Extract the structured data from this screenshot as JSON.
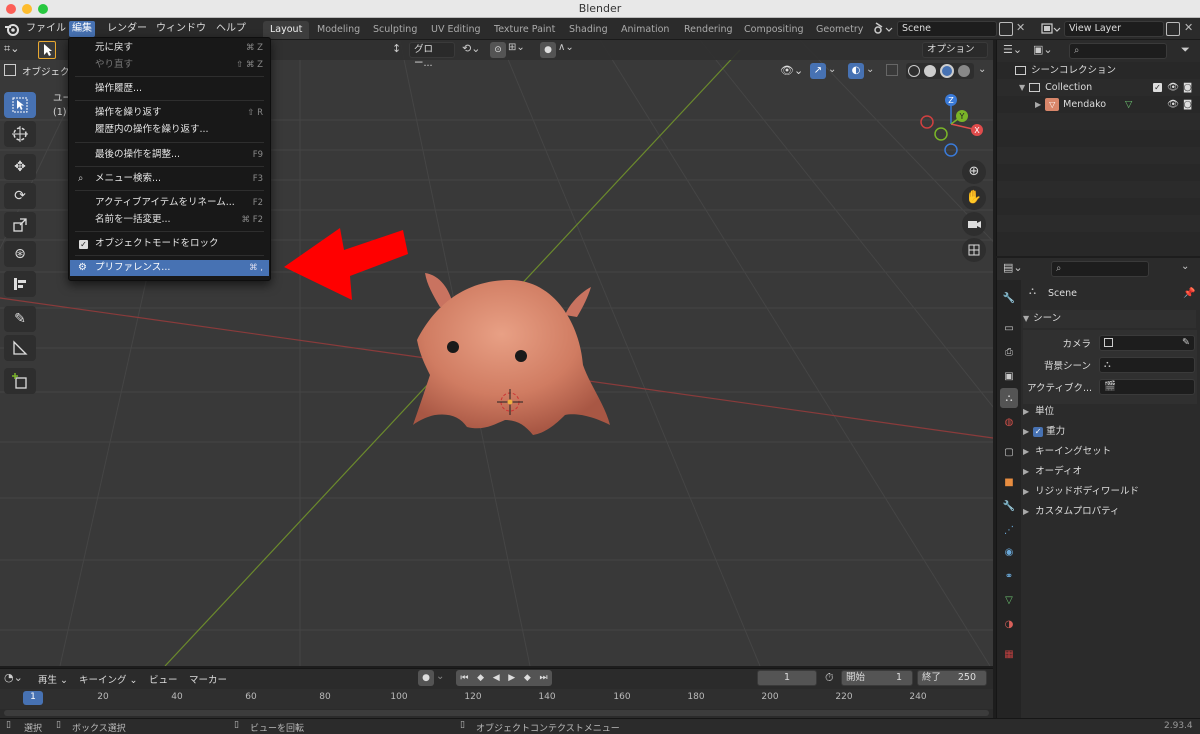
{
  "window": {
    "title": "Blender",
    "traffic_colors": [
      "#fc5f57",
      "#fdbc2e",
      "#28c840"
    ]
  },
  "menubar": {
    "items": [
      "ファイル",
      "編集",
      "レンダー",
      "ウィンドウ",
      "ヘルプ"
    ],
    "active_index": 1,
    "workspaces": [
      "Layout",
      "Modeling",
      "Sculpting",
      "UV Editing",
      "Texture Paint",
      "Shading",
      "Animation",
      "Rendering",
      "Compositing",
      "Geometry"
    ],
    "active_workspace": 0,
    "scene": "Scene",
    "view_layer": "View Layer"
  },
  "viewport": {
    "mode_label": "オブジェクト",
    "orientation": "グロー...",
    "options_label": "オプション",
    "info_line1": "ユー",
    "info_line2": "(1)",
    "gizmo_labels": {
      "z": "Z",
      "y": "Y",
      "x": "X"
    }
  },
  "edit_menu": {
    "items": [
      {
        "label": "元に戻す",
        "shortcut": "⌘ Z",
        "state": "normal"
      },
      {
        "label": "やり直す",
        "shortcut": "⇧ ⌘ Z",
        "state": "disabled"
      },
      {
        "label": "操作履歴...",
        "shortcut": "",
        "state": "normal"
      },
      {
        "label": "操作を繰り返す",
        "shortcut": "⇧ R",
        "state": "normal"
      },
      {
        "label": "履歴内の操作を繰り返す...",
        "shortcut": "",
        "state": "normal"
      },
      {
        "label": "最後の操作を調整...",
        "shortcut": "F9",
        "state": "normal"
      },
      {
        "label": "メニュー検索...",
        "shortcut": "F3",
        "state": "normal"
      },
      {
        "label": "アクティブアイテムをリネーム...",
        "shortcut": "F2",
        "state": "normal"
      },
      {
        "label": "名前を一括変更...",
        "shortcut": "⌘ F2",
        "state": "normal"
      },
      {
        "label": "オブジェクトモードをロック",
        "shortcut": "",
        "state": "normal"
      },
      {
        "label": "プリファレンス...",
        "shortcut": "⌘ ,",
        "state": "highlighted"
      }
    ]
  },
  "outliner": {
    "root": "シーンコレクション",
    "collection": "Collection",
    "object": "Mendako"
  },
  "properties": {
    "scene_name": "Scene",
    "panel_title": "シーン",
    "camera_label": "カメラ",
    "background_label": "背景シーン",
    "active_clip_label": "アクティブク...",
    "subpanels": [
      "単位",
      "重力",
      "キーイングセット",
      "オーディオ",
      "リジッドボディワールド",
      "カスタムプロパティ"
    ],
    "gravity_checked": true
  },
  "timeline": {
    "menus": [
      "再生",
      "キーイング",
      "ビュー",
      "マーカー"
    ],
    "current_frame": "1",
    "start_label": "開始",
    "start_value": "1",
    "end_label": "終了",
    "end_value": "250",
    "ticks": [
      "1",
      "20",
      "40",
      "60",
      "80",
      "100",
      "120",
      "140",
      "160",
      "180",
      "200",
      "220",
      "240"
    ]
  },
  "statusbar": {
    "select": "選択",
    "box_select": "ボックス選択",
    "rotate_view": "ビューを回転",
    "context_menu": "オブジェクトコンテクストメニュー",
    "version": "2.93.4"
  },
  "colors": {
    "accent": "#4772b3",
    "arrow": "#ff0000",
    "mendako": "#d8866a"
  }
}
